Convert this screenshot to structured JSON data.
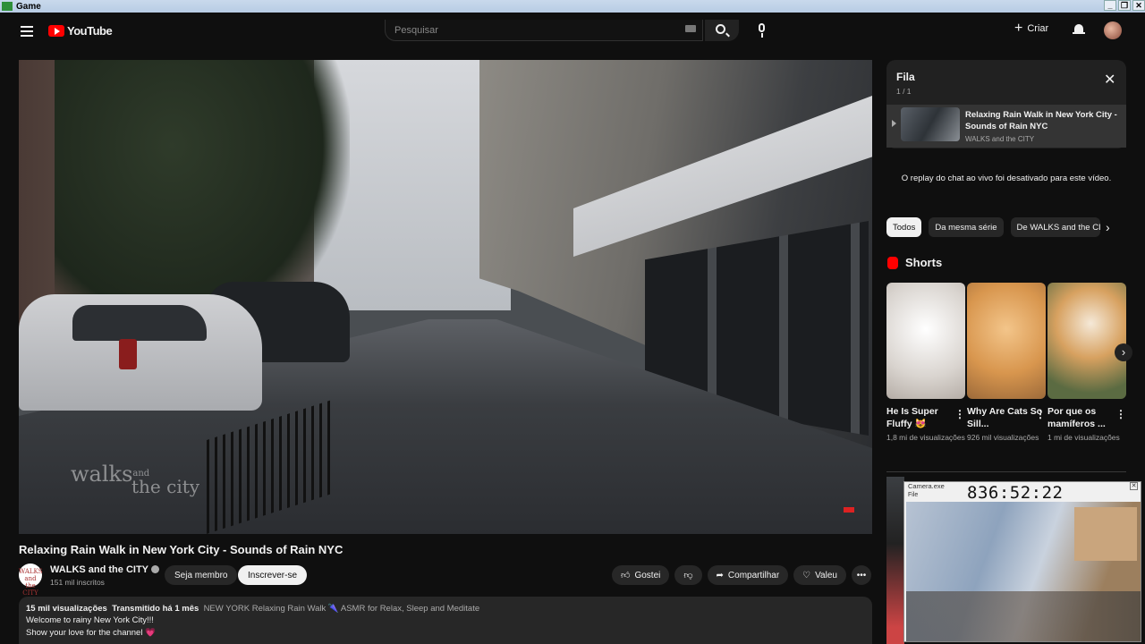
{
  "window": {
    "title": "Game",
    "controls": [
      "_",
      "❐",
      "✕"
    ]
  },
  "header": {
    "logo_text": "YouTube",
    "search_placeholder": "Pesquisar",
    "create_label": "Criar"
  },
  "video": {
    "title": "Relaxing Rain Walk in New York City - Sounds of Rain NYC",
    "watermark_line1": "walks",
    "watermark_line2": "the city",
    "watermark_and": "and"
  },
  "channel": {
    "name": "WALKS and the CITY",
    "subscribers": "151 mil inscritos",
    "avatar_text": "WALKS and the CITY",
    "join_label": "Seja membro",
    "subscribe_label": "Inscrever-se"
  },
  "actions": {
    "like_label": "Gostei",
    "share_label": "Compartilhar",
    "thanks_label": "Valeu"
  },
  "description": {
    "views": "15 mil visualizações",
    "streamed": "Transmitido há 1 mês",
    "tags": "NEW YORK Relaxing Rain Walk 🌂 ASMR for Relax, Sleep and Meditate",
    "line2": "Welcome to rainy New York City!!!",
    "line3": "Show your love for the channel 💗"
  },
  "queue": {
    "title": "Fila",
    "count": "1 / 1",
    "item_title": "Relaxing Rain Walk in New York City - Sounds of Rain NYC",
    "item_channel": "WALKS and the CITY"
  },
  "chat_notice": "O replay do chat ao vivo foi desativado para este vídeo.",
  "chips": [
    "Todos",
    "Da mesma série",
    "De WALKS and the CITY"
  ],
  "shorts": {
    "header": "Shorts",
    "items": [
      {
        "title": "He Is Super Fluffy 😻",
        "views": "1,8 mi de visualizações"
      },
      {
        "title": "Why Are Cats So Sill...",
        "views": "926 mil visualizações"
      },
      {
        "title": "Por que os mamíferos ...",
        "views": "1 mi de visualizações"
      }
    ]
  },
  "camera": {
    "title": "Camera.exe",
    "menu": "File",
    "time": "836:52:22"
  },
  "icons": [
    "hamburger-icon",
    "search-icon",
    "mic-icon",
    "plus-icon",
    "bell-icon",
    "close-icon",
    "like-icon",
    "dislike-icon",
    "share-icon",
    "thanks-icon",
    "more-icon",
    "chevron-right-icon"
  ]
}
